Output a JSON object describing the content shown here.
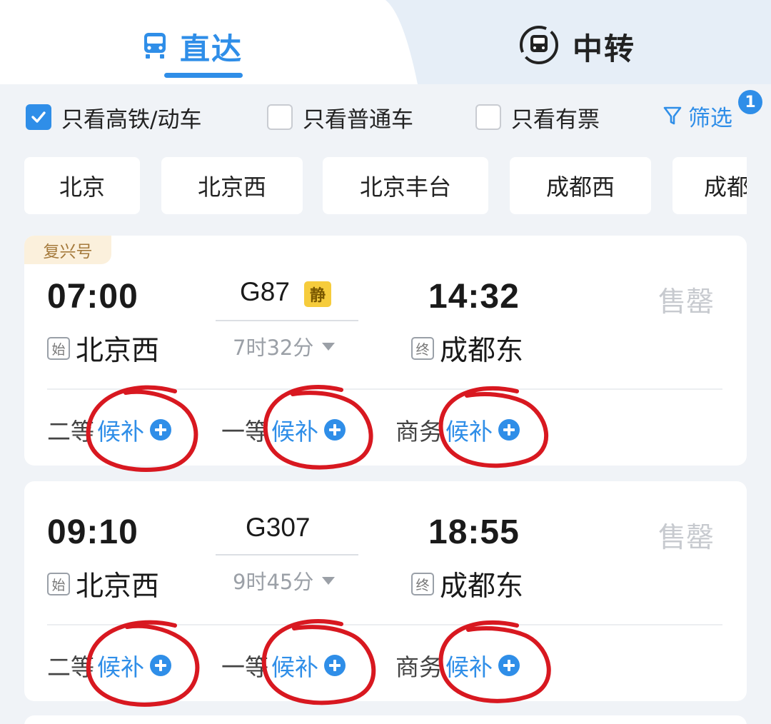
{
  "mode_tabs": {
    "direct_label": "直达",
    "transfer_label": "中转"
  },
  "filters": {
    "high_speed": {
      "label": "只看高铁/动车",
      "checked": true
    },
    "regular": {
      "label": "只看普通车",
      "checked": false
    },
    "available": {
      "label": "只看有票",
      "checked": false
    },
    "filter_label": "筛选",
    "filter_count": "1"
  },
  "stations": [
    "北京",
    "北京西",
    "北京丰台",
    "成都西",
    "成都"
  ],
  "trains": [
    {
      "brand": "复兴号",
      "depart_time": "07:00",
      "depart_mark": "始",
      "depart_station": "北京西",
      "train_no": "G87",
      "quiet_badge": "静",
      "duration": "7时32分",
      "arrive_time": "14:32",
      "arrive_mark": "终",
      "arrive_station": "成都东",
      "status": "售罄",
      "seats": [
        {
          "class": "二等",
          "action": "候补"
        },
        {
          "class": "一等",
          "action": "候补"
        },
        {
          "class": "商务",
          "action": "候补"
        }
      ]
    },
    {
      "depart_time": "09:10",
      "depart_mark": "始",
      "depart_station": "北京西",
      "train_no": "G307",
      "duration": "9时45分",
      "arrive_time": "18:55",
      "arrive_mark": "终",
      "arrive_station": "成都东",
      "status": "售罄",
      "seats": [
        {
          "class": "二等",
          "action": "候补"
        },
        {
          "class": "一等",
          "action": "候补"
        },
        {
          "class": "商务",
          "action": "候补"
        }
      ]
    }
  ],
  "colors": {
    "accent": "#2f8ee8",
    "annotation": "#d81820",
    "sold_out": "#c7cacf",
    "brand_tag_bg": "#fbf0dc"
  }
}
